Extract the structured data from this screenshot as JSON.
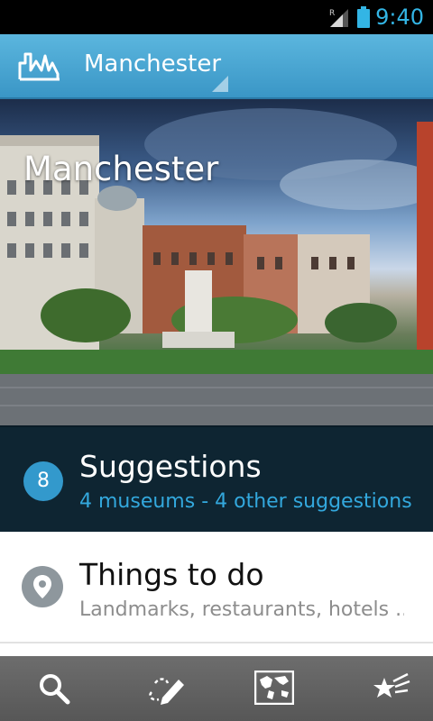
{
  "status_bar": {
    "time": "9:40",
    "network_label": "R"
  },
  "action_bar": {
    "title": "Manchester",
    "app_icon": "skyline-icon"
  },
  "hero": {
    "title": "Manchester"
  },
  "suggestions": {
    "count": "8",
    "title": "Suggestions",
    "subtitle": "4 museums - 4 other suggestions"
  },
  "things_to_do": {
    "title": "Things to do",
    "subtitle": "Landmarks, restaurants, hotels ..."
  },
  "toolbar": {
    "items": [
      {
        "icon": "search-icon"
      },
      {
        "icon": "pen-route-icon"
      },
      {
        "icon": "map-icon"
      },
      {
        "icon": "stars-icon"
      }
    ]
  },
  "colors": {
    "accent": "#33b5e5",
    "action_bar": "#4aa6d4",
    "suggest_bg": "#0e2532",
    "badge": "#3399cc",
    "toolbar": "#626262"
  }
}
